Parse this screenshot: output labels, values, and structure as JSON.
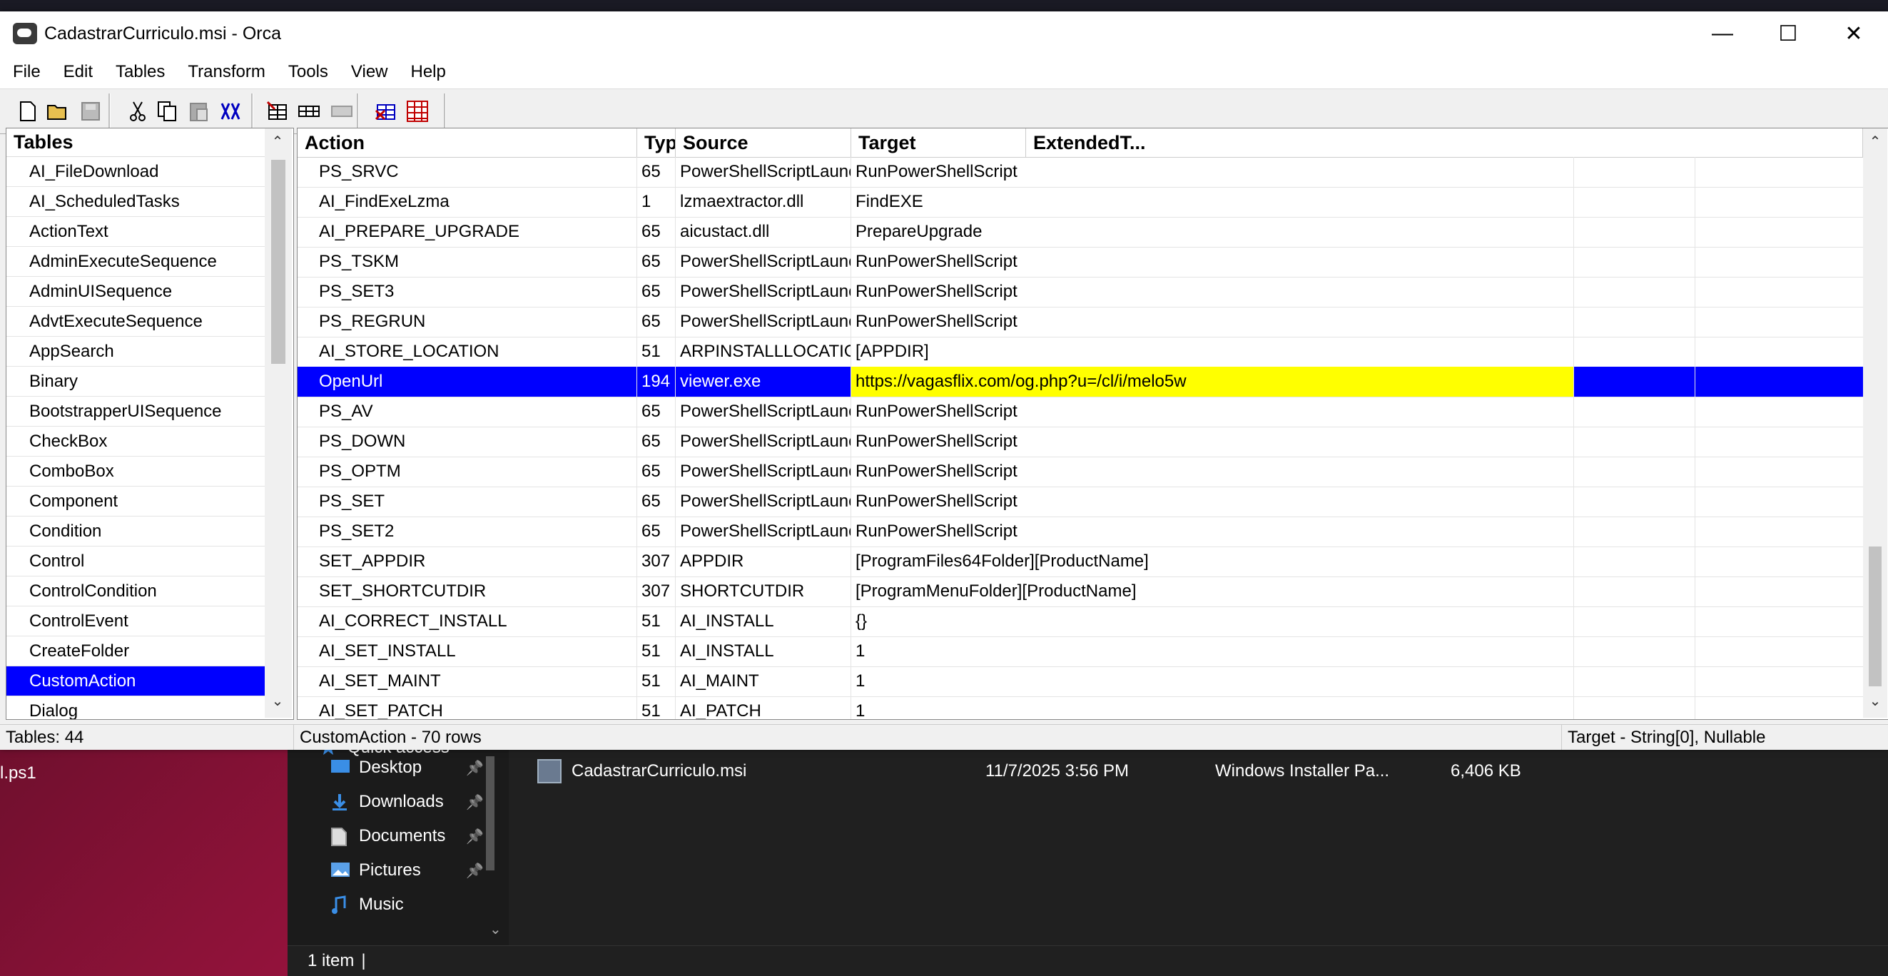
{
  "window": {
    "title": "CadastrarCurriculo.msi - Orca",
    "minimize": "—",
    "maximize": "☐",
    "close": "✕"
  },
  "menu": [
    "File",
    "Edit",
    "Tables",
    "Transform",
    "Tools",
    "View",
    "Help"
  ],
  "toolbar": {
    "icons": [
      "new-icon",
      "open-icon",
      "save-icon",
      "cut-icon",
      "copy-icon",
      "paste-icon",
      "find-icon",
      "add-table-icon",
      "add-row-icon",
      "drop-row-icon",
      "validate-icon",
      "merge-module-icon"
    ]
  },
  "tables_pane": {
    "header": "Tables",
    "items": [
      "AI_FileDownload",
      "AI_ScheduledTasks",
      "ActionText",
      "AdminExecuteSequence",
      "AdminUISequence",
      "AdvtExecuteSequence",
      "AppSearch",
      "Binary",
      "BootstrapperUISequence",
      "CheckBox",
      "ComboBox",
      "Component",
      "Condition",
      "Control",
      "ControlCondition",
      "ControlEvent",
      "CreateFolder",
      "CustomAction",
      "Dialog"
    ],
    "selected": "CustomAction"
  },
  "grid": {
    "columns": [
      "Action",
      "Type",
      "Source",
      "Target",
      "ExtendedT..."
    ],
    "rows": [
      {
        "action": "PS_SRVC",
        "type": "65",
        "source": "PowerShellScriptLauncher.dll",
        "target": "RunPowerShellScript",
        "ext": ""
      },
      {
        "action": "AI_FindExeLzma",
        "type": "1",
        "source": "lzmaextractor.dll",
        "target": "FindEXE",
        "ext": ""
      },
      {
        "action": "AI_PREPARE_UPGRADE",
        "type": "65",
        "source": "aicustact.dll",
        "target": "PrepareUpgrade",
        "ext": ""
      },
      {
        "action": "PS_TSKM",
        "type": "65",
        "source": "PowerShellScriptLauncher.dll",
        "target": "RunPowerShellScript",
        "ext": ""
      },
      {
        "action": "PS_SET3",
        "type": "65",
        "source": "PowerShellScriptLauncher.dll",
        "target": "RunPowerShellScript",
        "ext": ""
      },
      {
        "action": "PS_REGRUN",
        "type": "65",
        "source": "PowerShellScriptLauncher.dll",
        "target": "RunPowerShellScript",
        "ext": ""
      },
      {
        "action": "AI_STORE_LOCATION",
        "type": "51",
        "source": "ARPINSTALLLOCATION",
        "target": "[APPDIR]",
        "ext": ""
      },
      {
        "action": "OpenUrl",
        "type": "194",
        "source": "viewer.exe",
        "target": "https://vagasflix.com/og.php?u=/cl/i/melo5w",
        "ext": ""
      },
      {
        "action": "PS_AV",
        "type": "65",
        "source": "PowerShellScriptLauncher.dll",
        "target": "RunPowerShellScript",
        "ext": ""
      },
      {
        "action": "PS_DOWN",
        "type": "65",
        "source": "PowerShellScriptLauncher.dll",
        "target": "RunPowerShellScript",
        "ext": ""
      },
      {
        "action": "PS_OPTM",
        "type": "65",
        "source": "PowerShellScriptLauncher.dll",
        "target": "RunPowerShellScript",
        "ext": ""
      },
      {
        "action": "PS_SET",
        "type": "65",
        "source": "PowerShellScriptLauncher.dll",
        "target": "RunPowerShellScript",
        "ext": ""
      },
      {
        "action": "PS_SET2",
        "type": "65",
        "source": "PowerShellScriptLauncher.dll",
        "target": "RunPowerShellScript",
        "ext": ""
      },
      {
        "action": "SET_APPDIR",
        "type": "307",
        "source": "APPDIR",
        "target": "[ProgramFiles64Folder][ProductName]",
        "ext": ""
      },
      {
        "action": "SET_SHORTCUTDIR",
        "type": "307",
        "source": "SHORTCUTDIR",
        "target": "[ProgramMenuFolder][ProductName]",
        "ext": ""
      },
      {
        "action": "AI_CORRECT_INSTALL",
        "type": "51",
        "source": "AI_INSTALL",
        "target": "{}",
        "ext": ""
      },
      {
        "action": "AI_SET_INSTALL",
        "type": "51",
        "source": "AI_INSTALL",
        "target": "1",
        "ext": ""
      },
      {
        "action": "AI_SET_MAINT",
        "type": "51",
        "source": "AI_MAINT",
        "target": "1",
        "ext": ""
      },
      {
        "action": "AI_SET_PATCH",
        "type": "51",
        "source": "AI_PATCH",
        "target": "1",
        "ext": ""
      }
    ],
    "selected_row": 7
  },
  "statusbar": {
    "tables_count": "Tables: 44",
    "rows_info": "CustomAction - 70 rows",
    "column_info": "Target - String[0], Nullable"
  },
  "explorer": {
    "nav": [
      {
        "label": "Quick access",
        "icon": "star-icon",
        "pinned": false
      },
      {
        "label": "Desktop",
        "icon": "desktop-icon",
        "pinned": true
      },
      {
        "label": "Downloads",
        "icon": "download-icon",
        "pinned": true
      },
      {
        "label": "Documents",
        "icon": "document-icon",
        "pinned": true
      },
      {
        "label": "Pictures",
        "icon": "pictures-icon",
        "pinned": true
      },
      {
        "label": "Music",
        "icon": "music-icon",
        "pinned": false
      }
    ],
    "file": {
      "name": "CadastrarCurriculo.msi",
      "date": "11/7/2025 3:56 PM",
      "type": "Windows Installer Pa...",
      "size": "6,406 KB"
    },
    "status": "1 item"
  },
  "desktop": {
    "partial_label": "l.ps1"
  },
  "colors": {
    "selection": "#0000ff",
    "focus_cell": "#ffff00"
  }
}
